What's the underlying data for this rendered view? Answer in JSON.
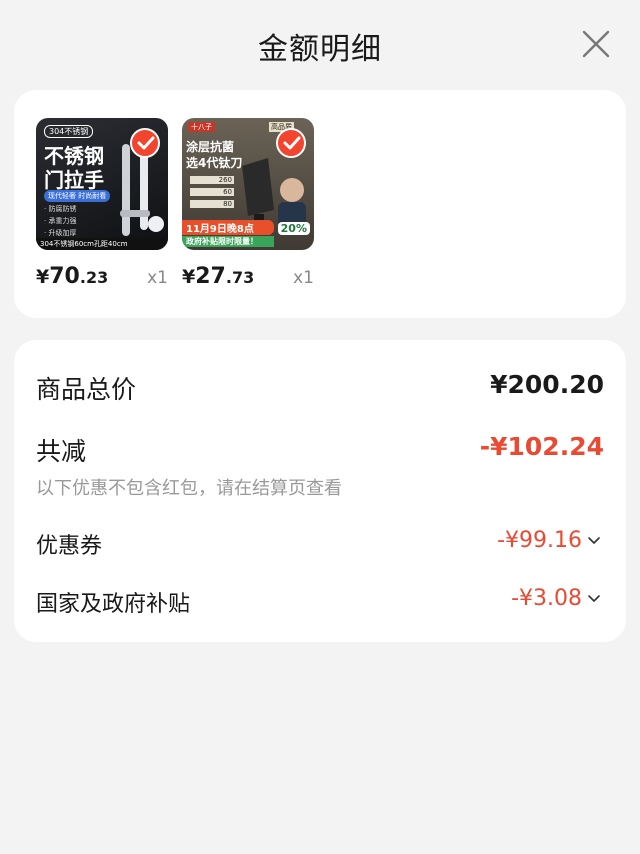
{
  "header": {
    "title": "金额明细"
  },
  "products": [
    {
      "price_currency": "¥",
      "price_int": "70",
      "price_dec": ".23",
      "qty": "x1",
      "thumb": {
        "tag": "304不锈钢",
        "headline1": "不锈钢",
        "headline2": "门拉手",
        "badge": "现代轻奢 时尚耐看",
        "bullets": [
          "· 防腐防锈",
          "· 承重力强",
          "· 升级加厚"
        ],
        "footer": "304不锈钢60cm孔距40cm"
      }
    },
    {
      "price_currency": "¥",
      "price_int": "27",
      "price_dec": ".73",
      "qty": "x1",
      "thumb": {
        "brand": "十八子",
        "corner": "高品质",
        "headline1": "涂层抗菌",
        "headline2": "选4代钛刀",
        "specs": [
          "260",
          "60",
          "80"
        ],
        "promo1": "11月9日晚8点",
        "promo2": "政府补贴限时限量！",
        "discount": "20%"
      }
    }
  ],
  "summary": {
    "total_label": "商品总价",
    "total_value": "¥200.20",
    "reduce_label": "共减",
    "reduce_value": "-¥102.24",
    "note": "以下优惠不包含红包，请在结算页查看",
    "items": [
      {
        "label": "优惠券",
        "value": "-¥99.16"
      },
      {
        "label": "国家及政府补贴",
        "value": "-¥3.08"
      }
    ]
  },
  "colors": {
    "accent": "#e84a33",
    "check": "#f2442f"
  }
}
